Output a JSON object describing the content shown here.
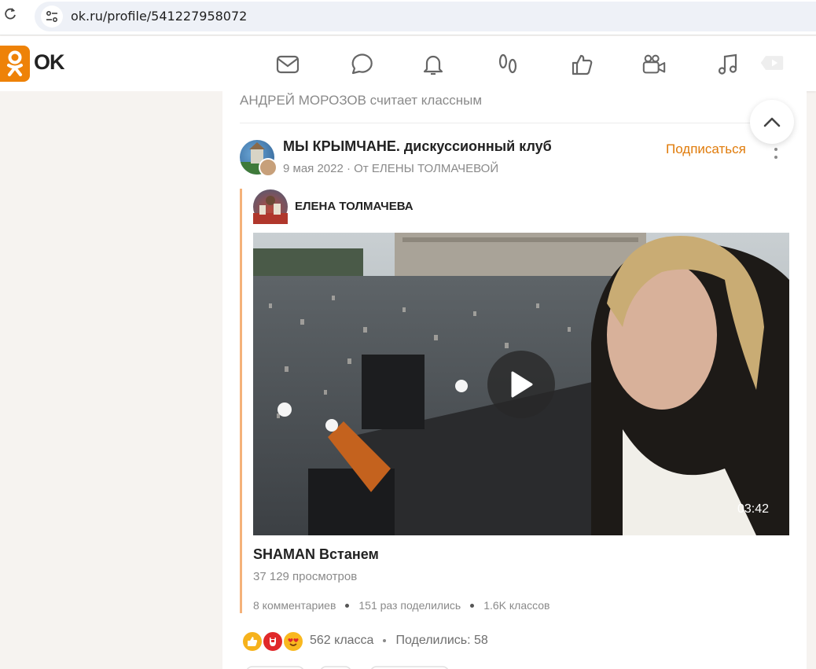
{
  "browser": {
    "url": "ok.ru/profile/541227958072",
    "reload_icon": "reload-icon",
    "site_info_icon": "site-settings-icon"
  },
  "header": {
    "logo_text": "OK",
    "brand_color": "#ee8208",
    "nav": [
      {
        "name": "messages",
        "icon": "envelope-icon"
      },
      {
        "name": "discussions",
        "icon": "chat-bubble-icon"
      },
      {
        "name": "notifications",
        "icon": "bell-icon"
      },
      {
        "name": "guests",
        "icon": "footprints-icon"
      },
      {
        "name": "events",
        "icon": "thumbs-up-icon"
      },
      {
        "name": "video",
        "icon": "video-camera-icon"
      },
      {
        "name": "music",
        "icon": "music-note-icon"
      },
      {
        "name": "video-play",
        "icon": "video-play-icon"
      }
    ]
  },
  "feed": {
    "liked_by": "АНДРЕЙ МОРОЗОВ считает классным",
    "group_name": "МЫ КРЫМЧАНЕ. дискуссионный клуб",
    "post_date": "9 мая 2022",
    "post_from": "От ЕЛЕНЫ ТОЛМАЧЕВОЙ",
    "subscribe_label": "Подписаться",
    "author_name": "ЕЛЕНА ТОЛМАЧЕВА",
    "video": {
      "duration": "03:42",
      "title": "SHAMAN Встанем",
      "views": "37 129 просмотров"
    },
    "stats": {
      "comments": "8 комментариев",
      "shares": "151 раз поделились",
      "classes": "1.6K классов"
    },
    "reactions": {
      "count": "562 класса",
      "shared": "Поделились: 58"
    }
  }
}
